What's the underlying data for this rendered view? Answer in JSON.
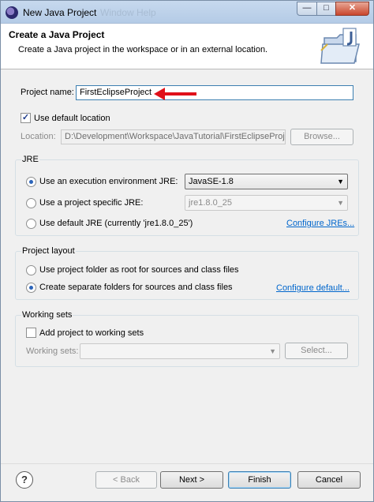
{
  "window": {
    "title": "New Java Project",
    "ghost_menu": "Window   Help",
    "min_glyph": "—",
    "max_glyph": "□",
    "close_glyph": "✕"
  },
  "banner": {
    "title": "Create a Java Project",
    "description": "Create a Java project in the workspace or in an external location.",
    "icon": "new-java-project-folder-icon"
  },
  "project": {
    "name_label": "Project name:",
    "name_value": "FirstEclipseProject",
    "use_default_label": "Use default location",
    "use_default_checked": true,
    "location_label": "Location:",
    "location_value": "D:\\Development\\Workspace\\JavaTutorial\\FirstEclipseProjec",
    "browse_label": "Browse..."
  },
  "jre": {
    "group_title": "JRE",
    "option_env_label": "Use an execution environment JRE:",
    "env_value": "JavaSE-1.8",
    "option_specific_label": "Use a project specific JRE:",
    "specific_value": "jre1.8.0_25",
    "option_default_label": "Use default JRE (currently 'jre1.8.0_25')",
    "configure_link": "Configure JREs...",
    "selected": "env"
  },
  "layout": {
    "group_title": "Project layout",
    "option_root_label": "Use project folder as root for sources and class files",
    "option_separate_label": "Create separate folders for sources and class files",
    "configure_link": "Configure default...",
    "selected": "separate"
  },
  "working_sets": {
    "group_title": "Working sets",
    "add_label": "Add project to working sets",
    "add_checked": false,
    "sets_label": "Working sets:",
    "sets_value": "",
    "select_label": "Select..."
  },
  "footer": {
    "help_glyph": "?",
    "back_label": "< Back",
    "next_label": "Next >",
    "finish_label": "Finish",
    "cancel_label": "Cancel"
  },
  "annotation": {
    "arrow_color": "#e0101a"
  }
}
